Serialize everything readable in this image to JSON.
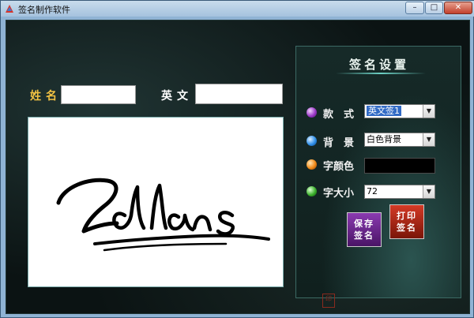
{
  "window": {
    "title": "签名制作软件",
    "min_symbol": "–",
    "max_symbol": "□",
    "close_symbol": "✕"
  },
  "form": {
    "name_label": "姓名",
    "name_value": "",
    "english_label": "英文",
    "english_value": ""
  },
  "preview": {
    "signature_text": "Zdlans"
  },
  "settings": {
    "title": "签名设置",
    "style_label": "款　式",
    "style_value": "英文签1",
    "background_label": "背　景",
    "background_value": "白色背景",
    "font_color_label": "字颜色",
    "font_color_value": "#000000",
    "font_size_label": "字大小",
    "font_size_value": "72",
    "save_line1": "保存",
    "save_line2": "签名",
    "print_line1": "打印",
    "print_line2": "签名"
  },
  "colors": {
    "name_label": "#f3c343",
    "accent_teal": "#6cd0c4",
    "save_button": "#6a2790",
    "print_button": "#b02a18"
  }
}
